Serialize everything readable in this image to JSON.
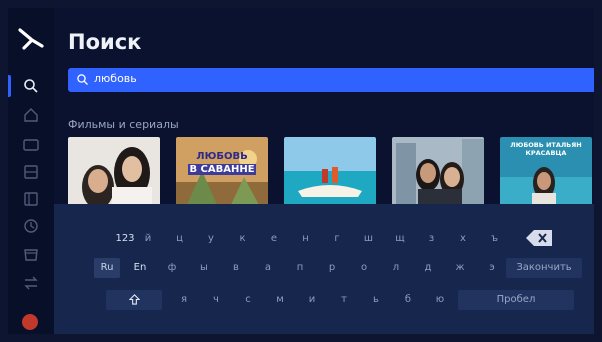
{
  "header": {
    "title": "Поиск"
  },
  "search": {
    "value": "любовь",
    "icon": "search-icon"
  },
  "section": {
    "title": "Фильмы и сериалы"
  },
  "posters": [
    {
      "title": ""
    },
    {
      "title_line1": "ЛЮБОВЬ",
      "title_line2": "В САВАННЕ"
    },
    {
      "title": ""
    },
    {
      "title": ""
    },
    {
      "title_line1": "ЛЮБОВЬ ИТАЛЬЯН",
      "title_line2": "КРАСАВЦА"
    }
  ],
  "keyboard": {
    "row1": [
      "123",
      "й",
      "ц",
      "у",
      "к",
      "е",
      "н",
      "г",
      "ш",
      "щ",
      "з",
      "х",
      "ъ"
    ],
    "row2_lang": [
      "Ru",
      "En"
    ],
    "row2": [
      "ф",
      "ы",
      "в",
      "а",
      "п",
      "р",
      "о",
      "л",
      "д",
      "ж",
      "э"
    ],
    "row2_action": "Закончить",
    "row3": [
      "я",
      "ч",
      "с",
      "м",
      "и",
      "т",
      "ь",
      "б",
      "ю"
    ],
    "row3_action": "Пробел",
    "backspace_icon": "backspace-icon",
    "shift_icon": "shift-icon"
  },
  "colors": {
    "accent": "#2f62ff",
    "background": "#0a1230",
    "keyboard": "#16264d"
  }
}
